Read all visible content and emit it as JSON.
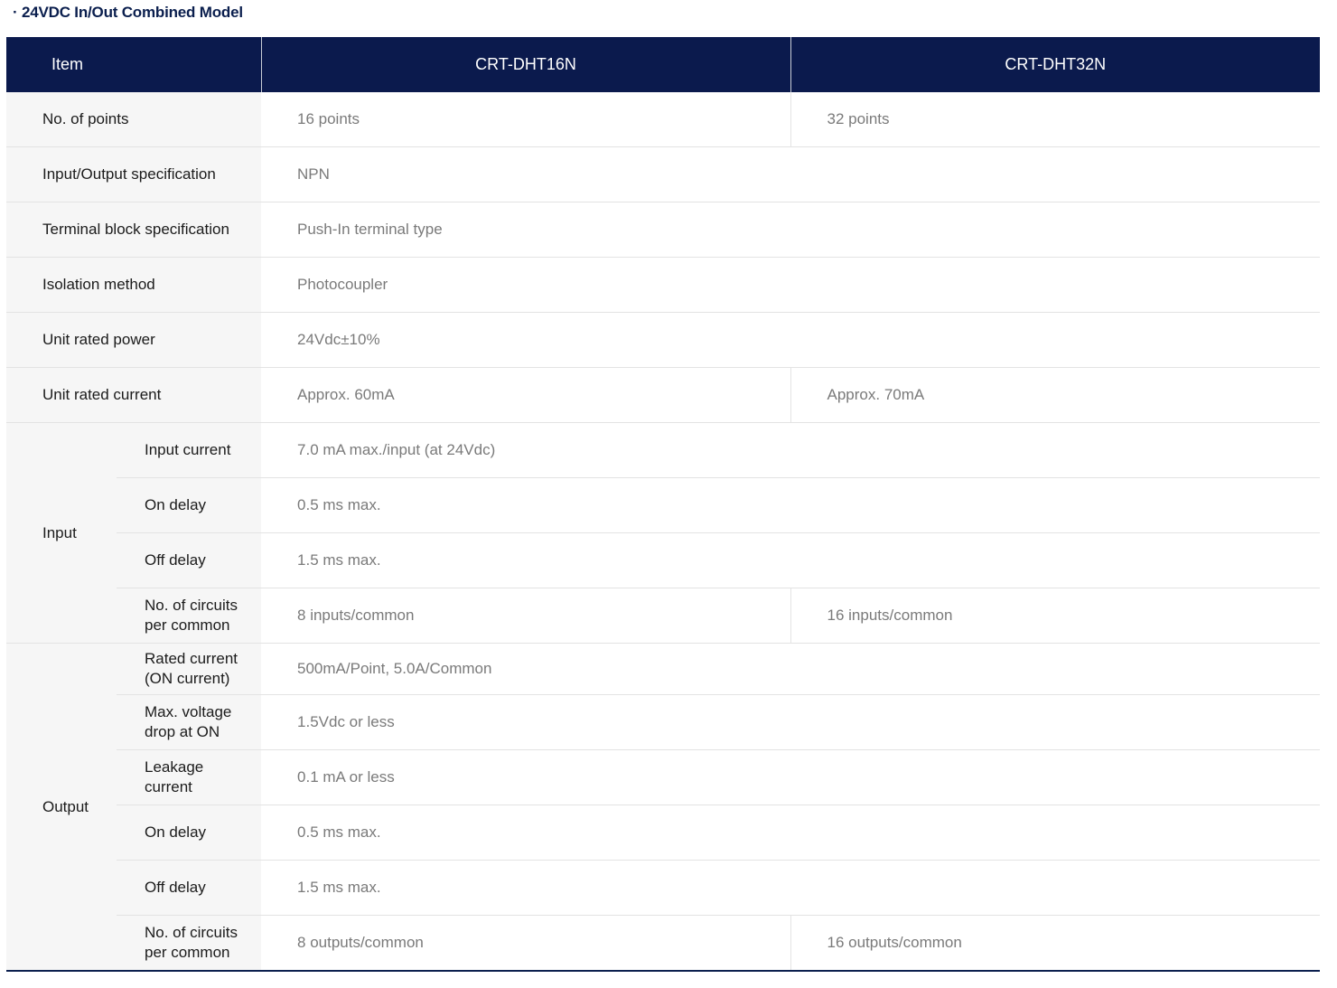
{
  "title": "· 24VDC In/Out Combined Model",
  "header": {
    "item": "Item",
    "model1": "CRT-DHT16N",
    "model2": "CRT-DHT32N"
  },
  "rows": {
    "points": {
      "label": "No. of points",
      "v1": "16 points",
      "v2": "32 points"
    },
    "io_spec": {
      "label": "Input/Output specification",
      "v": "NPN"
    },
    "terminal": {
      "label": "Terminal block specification",
      "v": "Push-In terminal type"
    },
    "isolation": {
      "label": "Isolation method",
      "v": "Photocoupler"
    },
    "power": {
      "label": "Unit rated power",
      "v": "24Vdc±10%"
    },
    "current": {
      "label": "Unit rated current",
      "v1": "Approx. 60mA",
      "v2": "Approx. 70mA"
    }
  },
  "input": {
    "label": "Input",
    "input_current": {
      "label": "Input current",
      "v": "7.0 mA max./input (at 24Vdc)"
    },
    "on_delay": {
      "label": "On delay",
      "v": "0.5 ms max."
    },
    "off_delay": {
      "label": "Off delay",
      "v": "1.5 ms max."
    },
    "circuits": {
      "label_1": "No. of circuits",
      "label_2": "per common",
      "v1": "8 inputs/common",
      "v2": "16 inputs/common"
    }
  },
  "output": {
    "label": "Output",
    "rated_current": {
      "label_1": "Rated current",
      "label_2": "(ON current)",
      "v": "500mA/Point, 5.0A/Common"
    },
    "voltage_drop": {
      "label_1": "Max. voltage",
      "label_2": "drop at ON",
      "v": "1.5Vdc or less"
    },
    "leakage": {
      "label_1": "Leakage",
      "label_2": "current",
      "v": "0.1 mA or less"
    },
    "on_delay": {
      "label": "On delay",
      "v": "0.5 ms max."
    },
    "off_delay": {
      "label": "Off delay",
      "v": "1.5 ms max."
    },
    "circuits": {
      "label_1": "No. of circuits",
      "label_2": "per common",
      "v1": "8 outputs/common",
      "v2": "16 outputs/common"
    }
  }
}
